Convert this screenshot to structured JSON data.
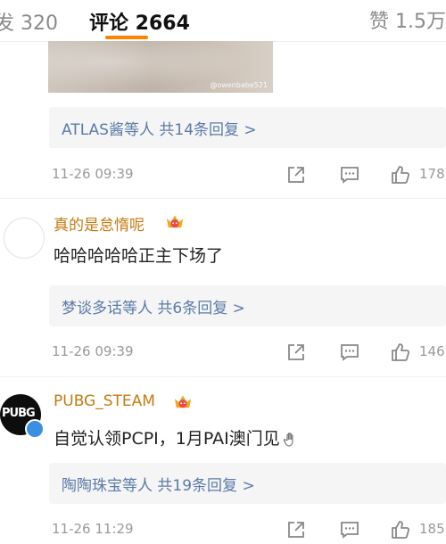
{
  "tabs": {
    "repost": "发 320",
    "comments": "评论 2664",
    "likes": "赞 1.5万"
  },
  "image": {
    "watermark": "@owenbabe521"
  },
  "thread1": {
    "replies": "ATLAS酱等人  共14条回复 >",
    "time": "11-26 09:39",
    "likes": "178"
  },
  "comment2": {
    "user": "真的是怠惰呢",
    "text": "哈哈哈哈哈正主下场了",
    "replies": "梦谈多话等人  共6条回复 >",
    "time": "11-26 09:39",
    "likes": "146"
  },
  "comment3": {
    "user": "PUBG_STEAM",
    "avatar_text": "PUBG",
    "text": "自觉认领PCPI，1月PAI澳门见",
    "replies": "陶陶珠宝等人  共19条回复 >",
    "time": "11-26 11:29",
    "likes": "185"
  },
  "icons": {
    "share": "share-icon",
    "comment": "comment-icon",
    "like": "thumbs-up-icon",
    "badge": "crown-badge-icon"
  },
  "colors": {
    "accent": "#ff8200",
    "link": "#5b7ba8",
    "username": "#c47b12",
    "meta": "#9a9a9a"
  }
}
